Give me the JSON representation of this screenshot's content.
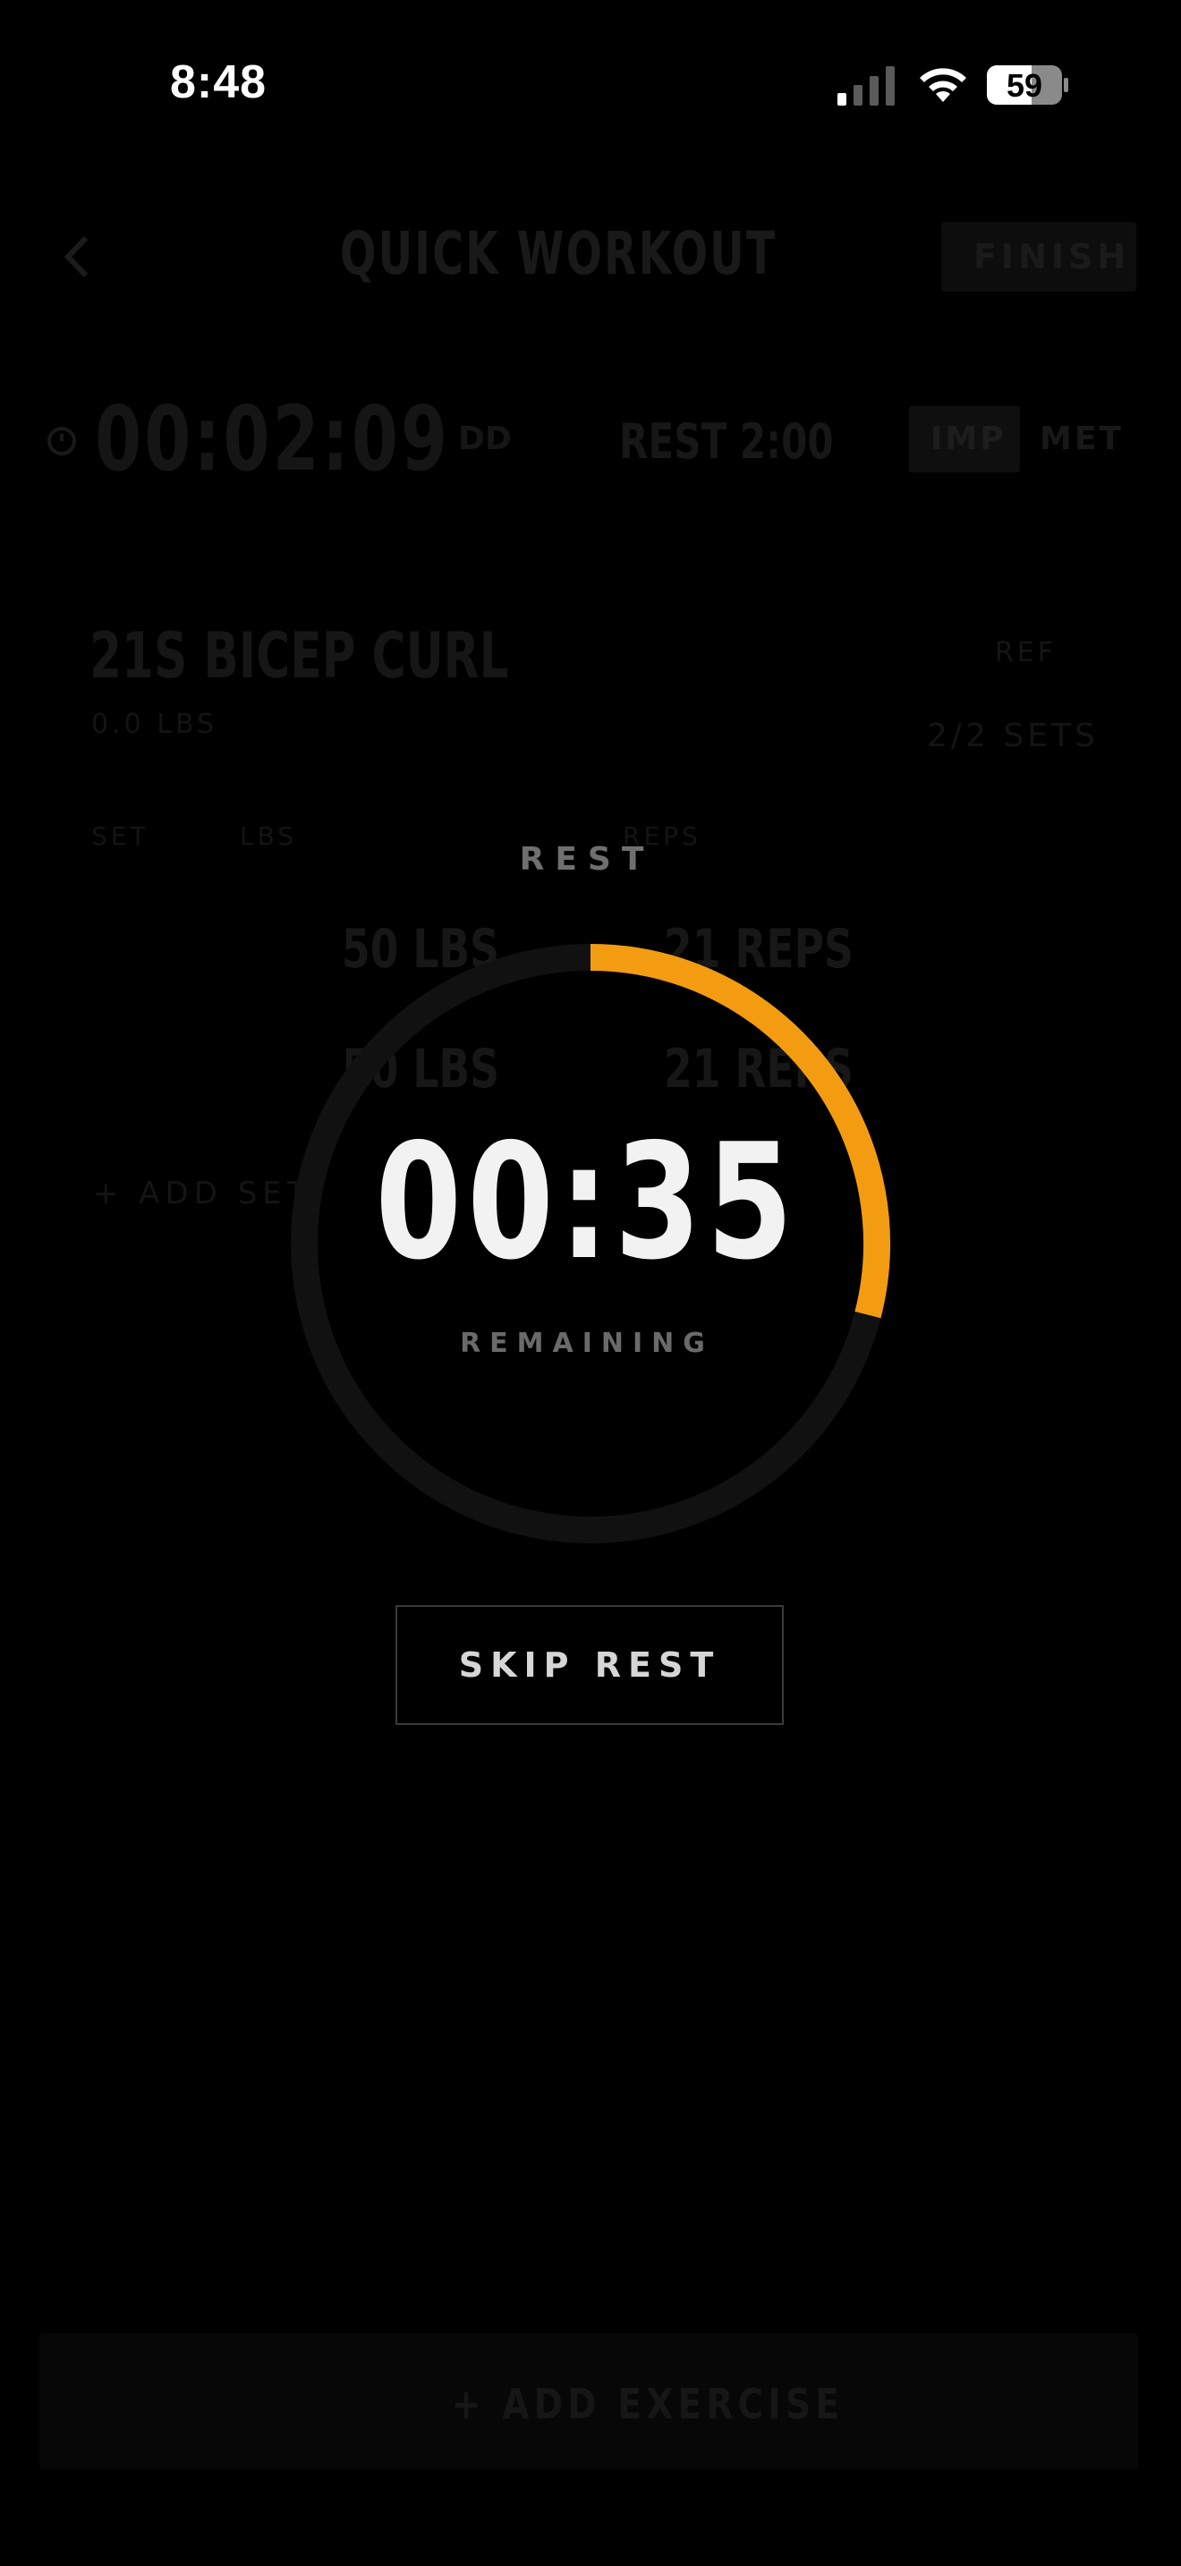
{
  "status_bar": {
    "time": "8:48",
    "battery": "59",
    "signal_icon": "cellular-signal-icon",
    "wifi_icon": "wifi-icon",
    "battery_icon": "battery-icon"
  },
  "background": {
    "title": "QUICK WORKOUT",
    "finish_label": "FINISH",
    "elapsed": "00:02:09",
    "elapsed_unit": "DD",
    "rest_setting": "REST 2:00",
    "unit_toggle": [
      "IMP",
      "MET"
    ],
    "exercise": {
      "name": "21S BICEP CURL",
      "sub": "0.0 LBS",
      "ref_label": "REF",
      "sets_label": "2/2 SETS",
      "columns": [
        "SET",
        "LBS",
        "REPS"
      ],
      "rows": [
        {
          "weight": "50 LBS",
          "reps": "21 REPS"
        },
        {
          "weight": "50 LBS",
          "reps": "21 REPS"
        }
      ],
      "add_set_label": "+ ADD SET"
    },
    "add_exercise_label": "+ ADD EXERCISE"
  },
  "rest_overlay": {
    "title": "REST",
    "countdown": "00:35",
    "remaining_label": "REMAINING",
    "skip_label": "SKIP REST",
    "progress_fraction": 0.29,
    "accent_color": "#f39c12",
    "track_color": "#111111"
  }
}
